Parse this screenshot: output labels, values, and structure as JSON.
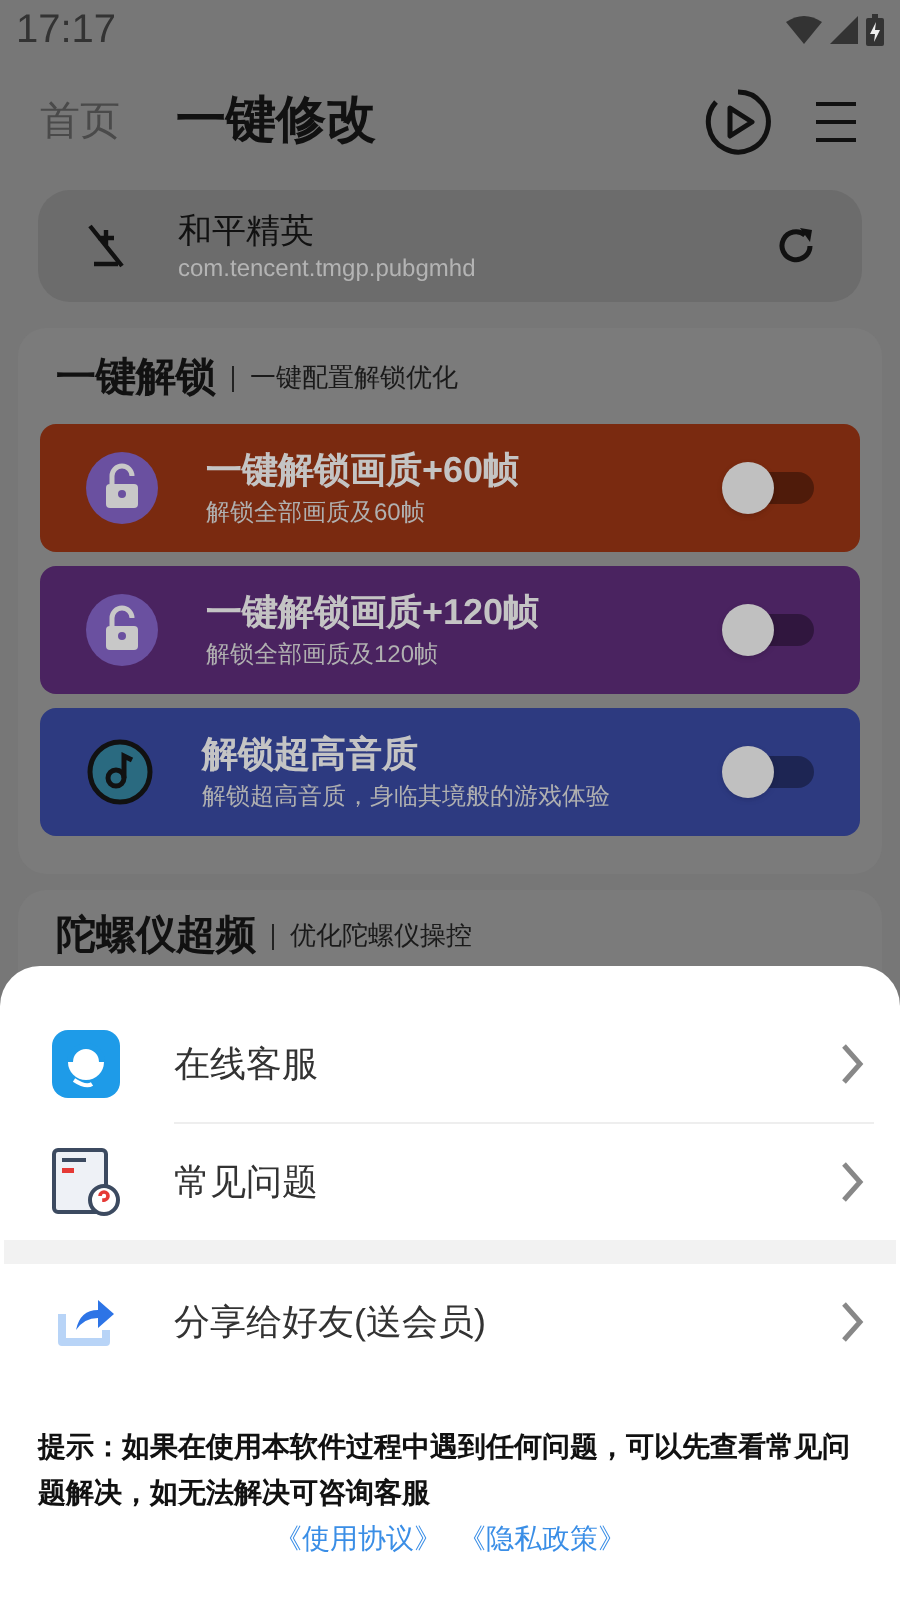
{
  "status_bar": {
    "time": "17:17"
  },
  "header": {
    "back_label": "首页",
    "title": "一键修改"
  },
  "app": {
    "name": "和平精英",
    "package": "com.tencent.tmgp.pubgmhd"
  },
  "sections": [
    {
      "title": "一键解锁",
      "subtitle": "一键配置解锁优化",
      "options": [
        {
          "kind": "lock",
          "title": "一键解锁画质+60帧",
          "subtitle": "解锁全部画质及60帧",
          "color": "#7a2a10",
          "on": false
        },
        {
          "kind": "lock",
          "title": "一键解锁画质+120帧",
          "subtitle": "解锁全部画质及120帧",
          "color": "#4a2360",
          "on": false
        },
        {
          "kind": "music",
          "title": "解锁超高音质",
          "subtitle": "解锁超高音质，身临其境般的游戏体验",
          "color": "#2d3a80",
          "on": false
        }
      ]
    },
    {
      "title": "陀螺仪超频",
      "subtitle": "优化陀螺仪操控"
    }
  ],
  "sheet": {
    "groups": [
      [
        {
          "kind": "support",
          "label": "在线客服"
        },
        {
          "kind": "faq",
          "label": "常见问题"
        }
      ],
      [
        {
          "kind": "share",
          "label": "分享给好友(送会员)"
        }
      ]
    ],
    "tip": "提示：如果在使用本软件过程中遇到任何问题，可以先查看常见问题解决，如无法解决可咨询客服",
    "links": [
      "《使用协议》",
      "《隐私政策》"
    ]
  }
}
